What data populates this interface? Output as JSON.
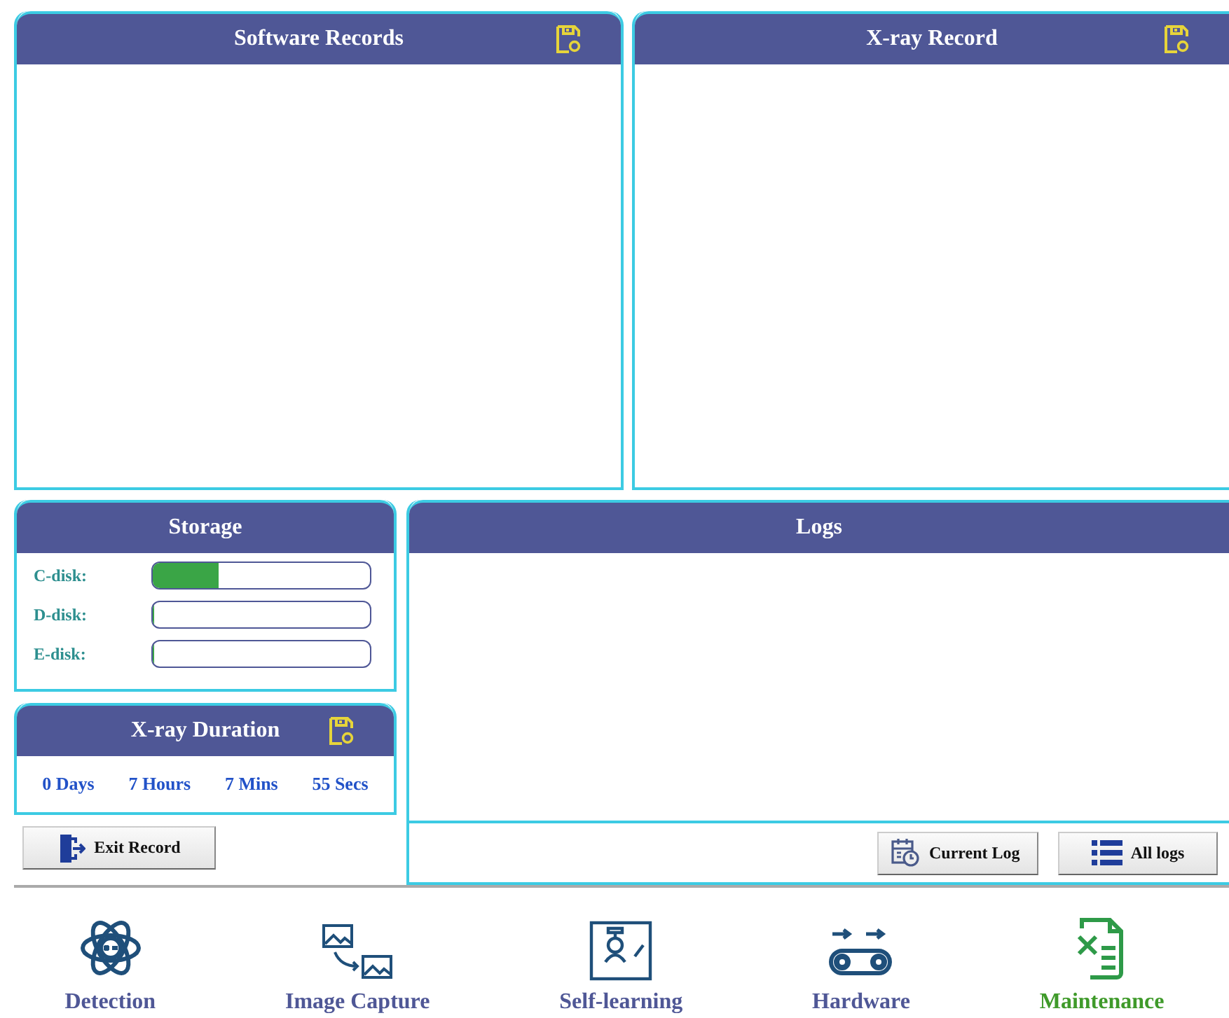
{
  "panels": [
    {
      "title": "Software Records"
    },
    {
      "title": "X-ray Record"
    }
  ],
  "storage": {
    "title": "Storage",
    "disks": [
      {
        "label": "C-disk:",
        "level": 0.3
      },
      {
        "label": "D-disk:",
        "level": 0
      },
      {
        "label": "E-disk:",
        "level": 0
      }
    ]
  },
  "xray_duration": {
    "title": "X-ray Duration",
    "values": [
      "0 Days",
      "7 Hours",
      "7 Mins",
      "55 Secs"
    ]
  },
  "exit_button": "Exit Record",
  "logs": {
    "title": "Logs",
    "buttons": [
      "Current Log",
      "All logs"
    ]
  },
  "nav": [
    {
      "label": "Detection",
      "selected": false
    },
    {
      "label": "Image Capture",
      "selected": false
    },
    {
      "label": "Self-learning",
      "selected": false
    },
    {
      "label": "Hardware",
      "selected": false
    },
    {
      "label": "Maintenance",
      "selected": true
    }
  ]
}
